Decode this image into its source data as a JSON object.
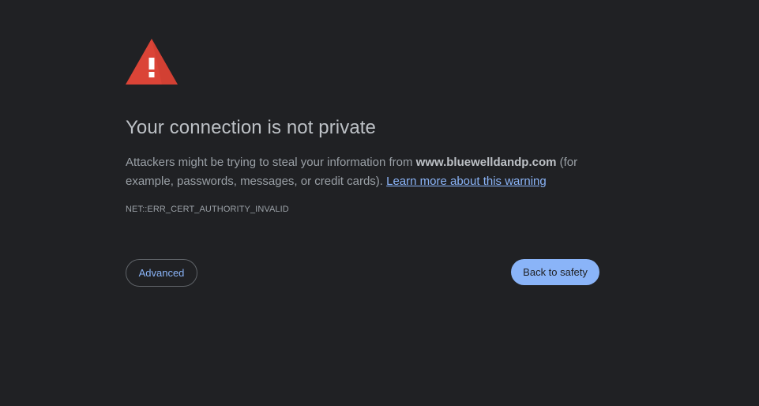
{
  "icon": {
    "name": "warning-triangle-icon",
    "color": "#db4437",
    "glyph": "!"
  },
  "heading": "Your connection is not private",
  "explanation": {
    "prefix": "Attackers might be trying to steal your information from ",
    "domain": "www.bluewelldandp.com",
    "suffix": " (for example, passwords, messages, or credit cards). ",
    "link_text": "Learn more about this warning"
  },
  "error_code": "NET::ERR_CERT_AUTHORITY_INVALID",
  "buttons": {
    "advanced_label": "Advanced",
    "back_label": "Back to safety"
  },
  "colors": {
    "background": "#202124",
    "accent": "#8ab4f8",
    "warning": "#db4437"
  }
}
